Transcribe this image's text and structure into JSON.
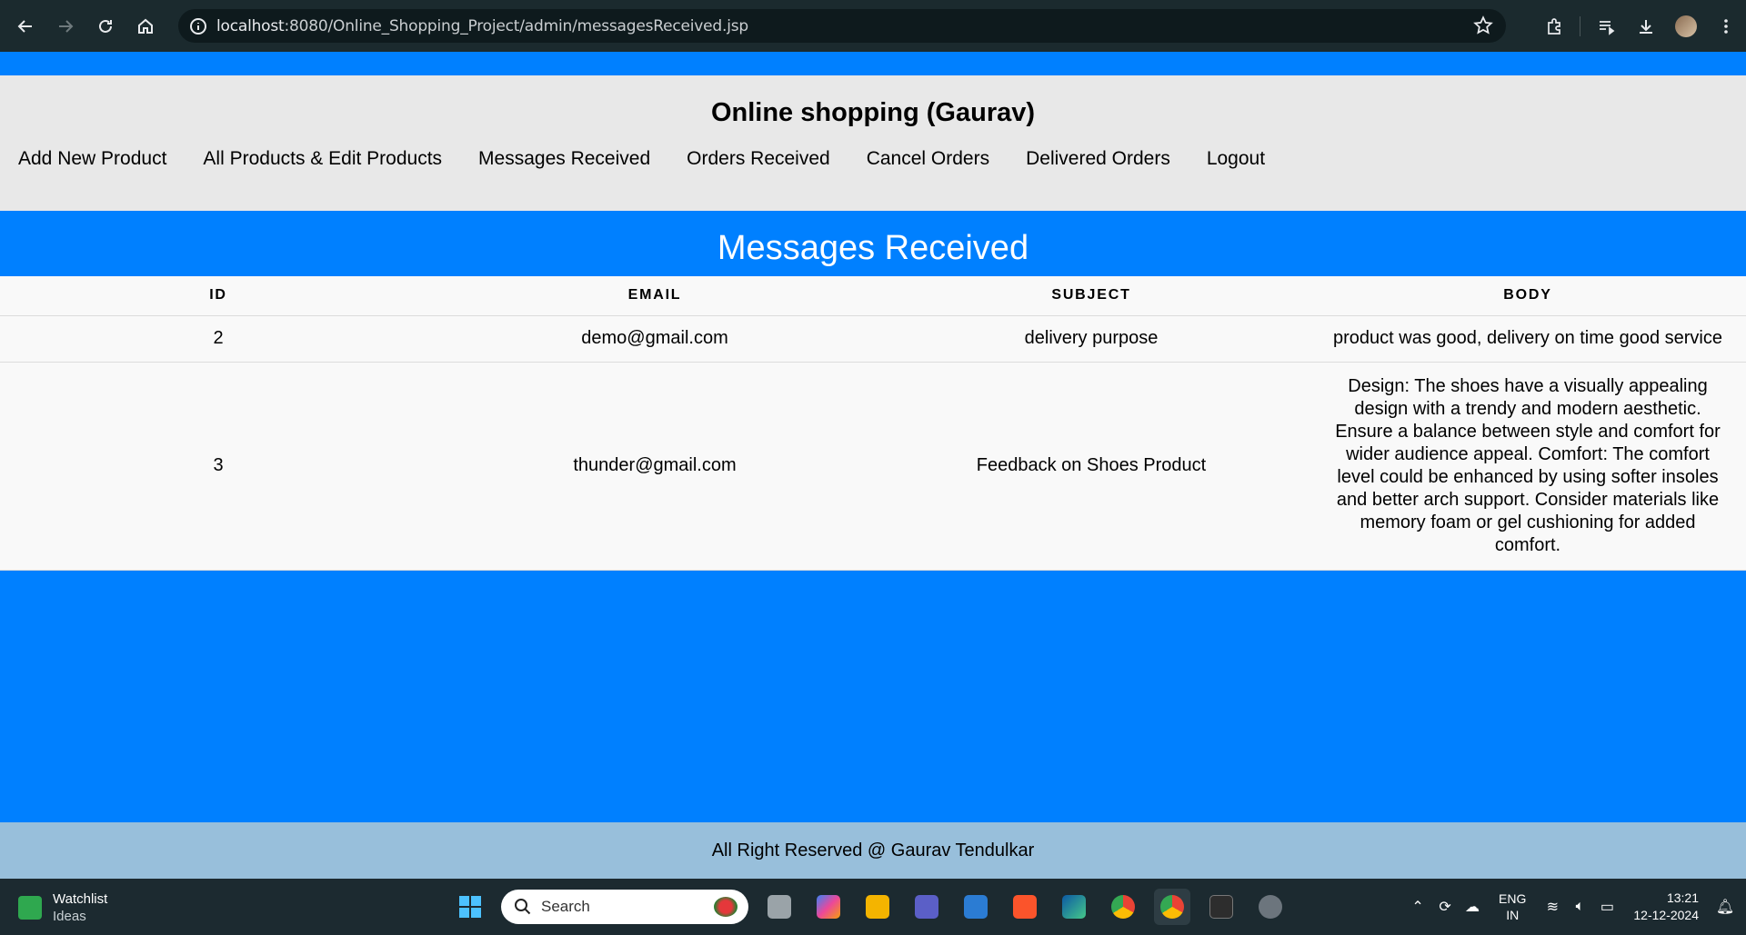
{
  "browser": {
    "url_host": "localhost",
    "url_rest": ":8080/Online_Shopping_Project/admin/messagesReceived.jsp"
  },
  "site": {
    "title": "Online shopping (Gaurav)",
    "nav": [
      {
        "label": "Add New Product"
      },
      {
        "label": "All Products & Edit Products"
      },
      {
        "label": "Messages Received"
      },
      {
        "label": "Orders Received"
      },
      {
        "label": "Cancel Orders"
      },
      {
        "label": "Delivered Orders"
      },
      {
        "label": "Logout"
      }
    ]
  },
  "main": {
    "heading": "Messages Received",
    "table": {
      "headers": [
        "ID",
        "EMAIL",
        "SUBJECT",
        "BODY"
      ],
      "rows": [
        {
          "id": "2",
          "email": "demo@gmail.com",
          "subject": "delivery purpose",
          "body": "product was good, delivery on time good service"
        },
        {
          "id": "3",
          "email": "thunder@gmail.com",
          "subject": "Feedback on Shoes Product",
          "body": "Design: The shoes have a visually appealing design with a trendy and modern aesthetic. Ensure a balance between style and comfort for wider audience appeal. Comfort: The comfort level could be enhanced by using softer insoles and better arch support. Consider materials like memory foam or gel cushioning for added comfort."
        }
      ]
    }
  },
  "footer": {
    "text": "All Right Reserved @ Gaurav Tendulkar"
  },
  "taskbar": {
    "widget_title": "Watchlist",
    "widget_sub": "Ideas",
    "search_placeholder": "Search",
    "lang_top": "ENG",
    "lang_bottom": "IN",
    "time": "13:21",
    "date": "12-12-2024"
  },
  "colors": {
    "page_blue": "#0080ff",
    "header_gray": "#e8e8e8",
    "footer_blue": "#98bfdb"
  }
}
